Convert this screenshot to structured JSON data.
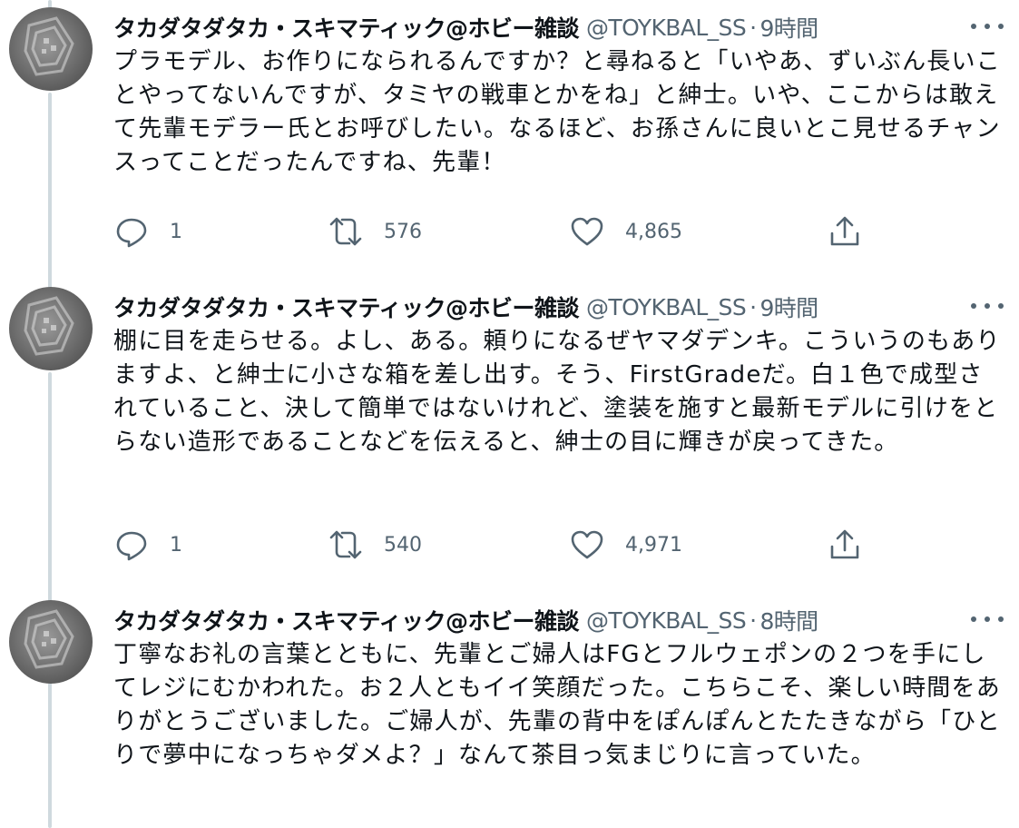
{
  "tweets": [
    {
      "display_name": "タカダタダタカ・スキマティック@ホビー雑談",
      "handle": "@TOYKBAL_SS",
      "separator": "·",
      "time": "9時間",
      "text": "プラモデル、お作りになられるんですか？と尋ねると「いやあ、ずいぶん長いことやってないんですが、タミヤの戦車とかをね」と紳士。いや、ここからは敢えて先輩モデラー氏とお呼びしたい。なるほど、お孫さんに良いとこ見せるチャンスってことだったんですね、先輩！",
      "replies": "1",
      "retweets": "576",
      "likes": "4,865"
    },
    {
      "display_name": "タカダタダタカ・スキマティック@ホビー雑談",
      "handle": "@TOYKBAL_SS",
      "separator": "·",
      "time": "9時間",
      "text": "棚に目を走らせる。よし、ある。頼りになるぜヤマダデンキ。こういうのもありますよ、と紳士に小さな箱を差し出す。そう、FirstGradeだ。白１色で成型されていること、決して簡単ではないけれど、塗装を施すと最新モデルに引けをとらない造形であることなどを伝えると、紳士の目に輝きが戻ってきた。",
      "replies": "1",
      "retweets": "540",
      "likes": "4,971"
    },
    {
      "display_name": "タカダタダタカ・スキマティック@ホビー雑談",
      "handle": "@TOYKBAL_SS",
      "separator": "·",
      "time": "8時間",
      "text": "丁寧なお礼の言葉とともに、先輩とご婦人はFGとフルウェポンの２つを手にしてレジにむかわれた。お２人ともイイ笑顔だった。こちらこそ、楽しい時間をありがとうございました。ご婦人が、先輩の背中をぽんぽんとたたきながら「ひとりで夢中になっちゃダメよ？」なんて茶目っ気まじりに言っていた。"
    }
  ],
  "icons": {
    "reply": "reply-icon",
    "retweet": "retweet-icon",
    "like": "heart-icon",
    "share": "share-icon",
    "more": "more-icon"
  },
  "colors": {
    "text": "#0f1419",
    "muted": "#536471",
    "thread_line": "#cfd9de"
  }
}
